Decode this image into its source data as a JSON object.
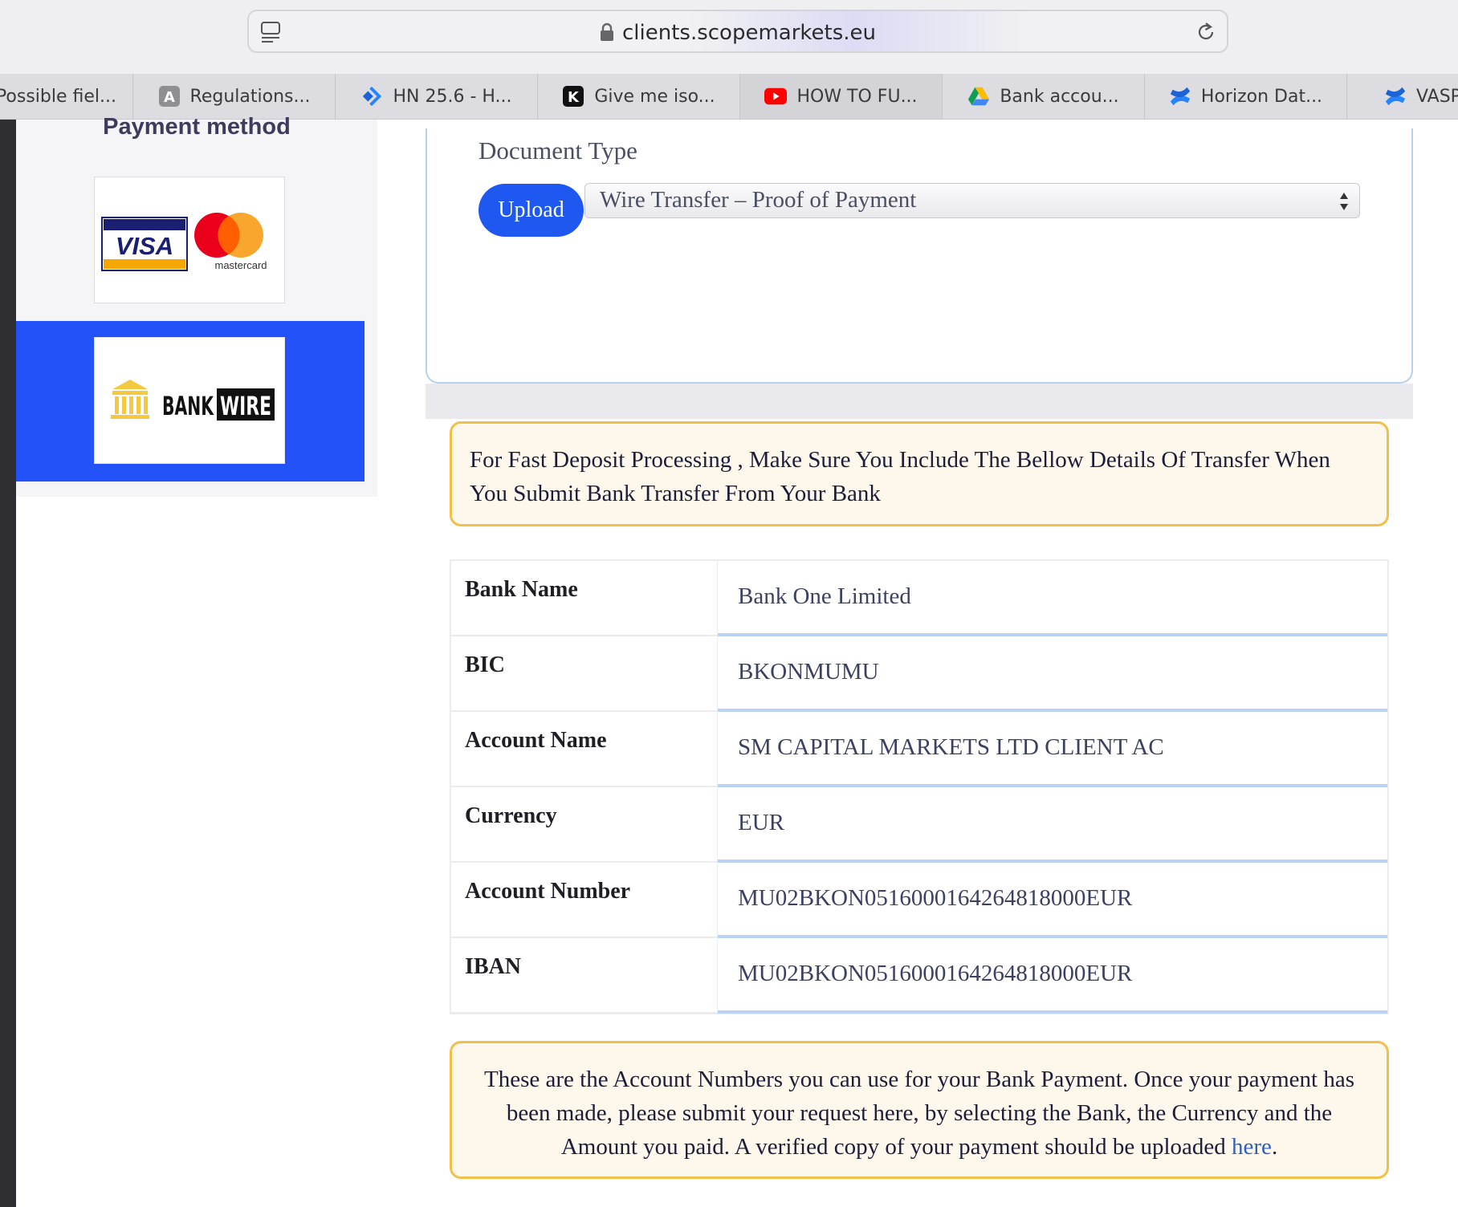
{
  "browser": {
    "url": "clients.scopemarkets.eu",
    "tabs": [
      {
        "label": "Possible fiel...",
        "icon": "none"
      },
      {
        "label": "Regulations...",
        "icon": "letter-a-icon"
      },
      {
        "label": "HN 25.6 - H...",
        "icon": "jira-icon"
      },
      {
        "label": "Give me iso...",
        "icon": "k-logo-icon"
      },
      {
        "label": "HOW TO FU...",
        "icon": "youtube-icon"
      },
      {
        "label": "Bank accou...",
        "icon": "google-drive-icon"
      },
      {
        "label": "Horizon Dat...",
        "icon": "confluence-icon"
      },
      {
        "label": "VASP",
        "icon": "confluence-icon"
      }
    ]
  },
  "sidebar": {
    "title": "Payment method",
    "card_logos": {
      "visa": "VISA",
      "mastercard": "mastercard"
    },
    "bank_wire": {
      "word1": "BANK",
      "word2": "WIRE"
    },
    "selected_color": "#2352f8"
  },
  "document": {
    "label": "Document Type",
    "upload_label": "Upload",
    "selected_type": "Wire Transfer – Proof of Payment"
  },
  "notice_top": "For Fast Deposit Processing , Make Sure You Include The Bellow Details Of Transfer When You Submit Bank Transfer From Your Bank",
  "bank_details": [
    {
      "label": "Bank Name",
      "value": "Bank One Limited"
    },
    {
      "label": "BIC",
      "value": "BKONMUMU"
    },
    {
      "label": "Account Name",
      "value": "SM CAPITAL MARKETS LTD CLIENT AC"
    },
    {
      "label": "Currency",
      "value": "EUR"
    },
    {
      "label": "Account Number",
      "value": "MU02BKON0516000164264818000EUR"
    },
    {
      "label": "IBAN",
      "value": "MU02BKON0516000164264818000EUR"
    }
  ],
  "notice_bottom": {
    "text": "These are the Account Numbers you can use for your Bank Payment. Once your payment has been made, please submit your request here, by selecting the Bank, the Currency and the Amount you paid. A verified copy of your payment should be uploaded ",
    "link": "here",
    "suffix": "."
  },
  "colors": {
    "accent": "#1f58f0",
    "notice_border": "#f1c04a",
    "notice_bg": "#fef8ec"
  }
}
